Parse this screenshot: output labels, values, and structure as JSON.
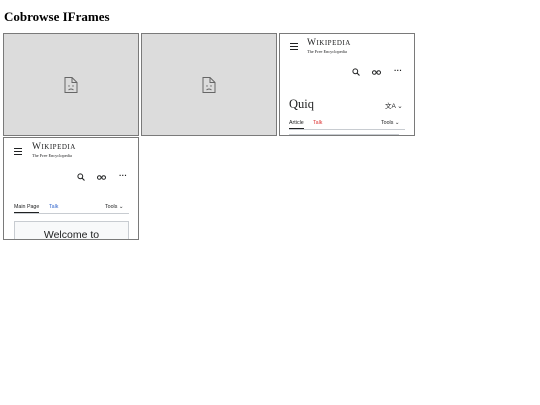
{
  "page": {
    "title": "Cobrowse IFrames"
  },
  "frames": {
    "f3": {
      "wordmark": "Wikipedia",
      "tagline": "The Free Encyclopedia",
      "article_title": "Quiq",
      "tabs": [
        "Article",
        "Talk"
      ],
      "tools_label": "Tools",
      "lang_icon": "translate-icon"
    },
    "f4": {
      "wordmark": "Wikipedia",
      "tagline": "The Free Encyclopedia",
      "tabs": [
        "Main Page",
        "Talk"
      ],
      "tools_label": "Tools",
      "welcome": "Welcome to"
    }
  },
  "colors": {
    "link_red": "#dd3333",
    "link_blue": "#3366cc",
    "broken_bg": "#dcdcdc"
  }
}
